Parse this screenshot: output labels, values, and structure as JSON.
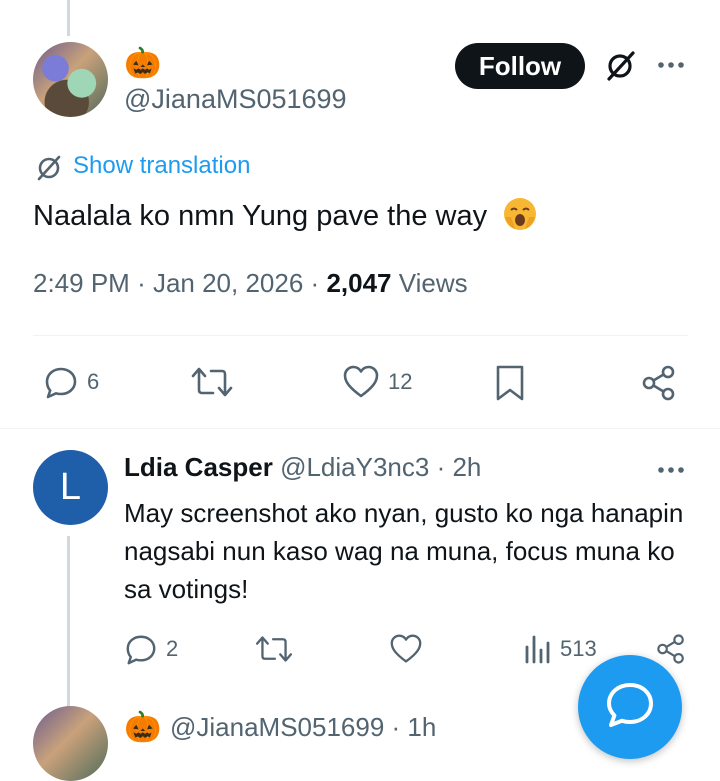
{
  "tweet": {
    "author_emoji": "🎃",
    "author_handle": "@JianaMS051699",
    "follow_label": "Follow",
    "translate_label": "Show translation",
    "text": "Naalala ko nmn Yung pave the way",
    "meta": {
      "time": "2:49 PM",
      "date": "Jan 20, 2026",
      "views_count": "2,047",
      "views_label": "Views"
    },
    "actions": {
      "replies": "6",
      "retweets": "",
      "likes": "12"
    }
  },
  "reply": {
    "avatar_letter": "L",
    "name": "Ldia Casper",
    "handle": "@LdiaY3nc3",
    "time": "2h",
    "text": "May screenshot ako nyan, gusto ko nga hanapin nagsabi nun kaso wag na muna, focus muna ko sa votings!",
    "actions": {
      "replies": "2",
      "retweets": "",
      "likes": "",
      "views": "513"
    }
  },
  "next_tweet_partial": {
    "emoji": "🎃",
    "handle_partial": "@JianaMS051699 · 1h"
  },
  "colors": {
    "accent": "#1d9bf0",
    "text_primary": "#0f1419",
    "text_secondary": "#536471",
    "avatar_reply_bg": "#1f5faa"
  }
}
